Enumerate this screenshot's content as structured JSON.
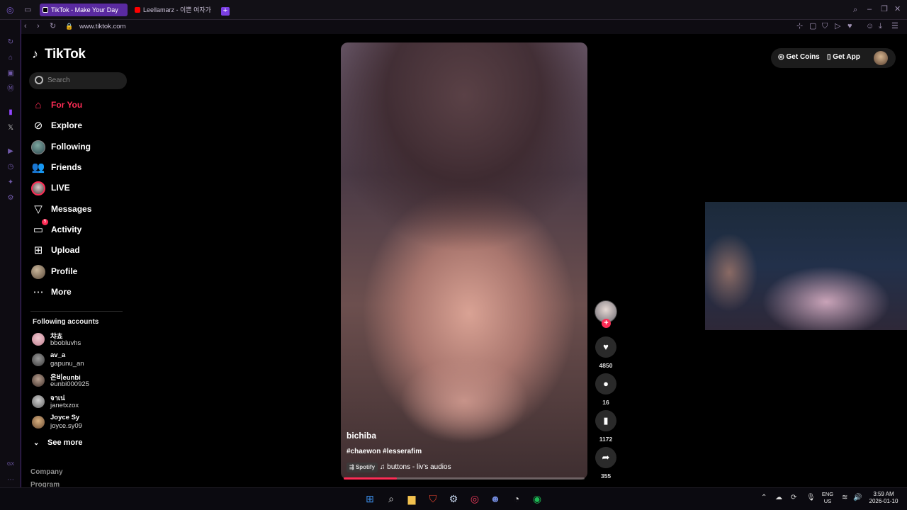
{
  "browser": {
    "tabs": [
      {
        "label": "TikTok - Make Your Day",
        "active": true
      },
      {
        "label": "Leellamarz - 이쁜 여자가 ",
        "active": false
      }
    ],
    "new_tab_label": "+",
    "url": "www.tiktok.com",
    "accent_color": "#5a2aa0"
  },
  "tiktok": {
    "logo": "TikTok",
    "search_placeholder": "Search",
    "nav": [
      {
        "label": "For You",
        "icon": "home-icon",
        "active": true
      },
      {
        "label": "Explore",
        "icon": "compass-icon"
      },
      {
        "label": "Following",
        "icon": "following-avatar-icon"
      },
      {
        "label": "Friends",
        "icon": "friends-icon"
      },
      {
        "label": "LIVE",
        "icon": "live-icon"
      },
      {
        "label": "Messages",
        "icon": "messages-icon"
      },
      {
        "label": "Activity",
        "icon": "activity-icon",
        "badge": "5"
      },
      {
        "label": "Upload",
        "icon": "upload-icon"
      },
      {
        "label": "Profile",
        "icon": "profile-avatar-icon"
      },
      {
        "label": "More",
        "icon": "more-icon"
      }
    ],
    "following_title": "Following accounts",
    "following_accounts": [
      {
        "display": "챠쵸",
        "handle": "bbobluvhs"
      },
      {
        "display": "av_a",
        "handle": "gapunu_an"
      },
      {
        "display": "은비eunbi",
        "handle": "eunbi000925"
      },
      {
        "display": "จาเน่",
        "handle": "janetxzox"
      },
      {
        "display": "Joyce Sy",
        "handle": "joyce.sy09"
      }
    ],
    "see_more": "See more",
    "footer_links": [
      "Company",
      "Program"
    ],
    "top_buttons": {
      "coins": "Get Coins",
      "app": "Get App"
    },
    "video": {
      "author": "bichiba",
      "tags": "#chaewon #lesserafim",
      "music_source": "Spotify",
      "music": "buttons - liv's audios",
      "progress_fraction": 0.22
    },
    "actions": {
      "likes": "4850",
      "comments": "16",
      "saves": "1172",
      "shares": "355"
    },
    "brand_color": "#fe2c55"
  },
  "taskbar": {
    "lang1": "ENG",
    "lang2": "US",
    "time": "3:59 AM",
    "date": "2026-01-10"
  }
}
